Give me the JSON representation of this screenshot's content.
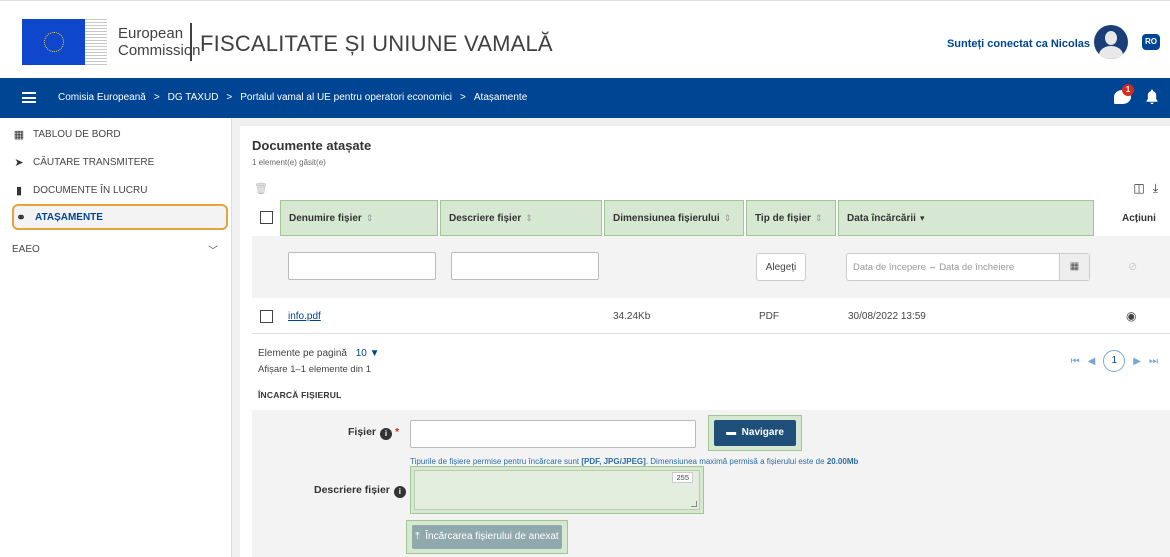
{
  "header": {
    "ec_line1": "European",
    "ec_line2": "Commission",
    "site_title": "FISCALITATE ȘI UNIUNE VAMALĂ",
    "user_label": "Sunteți conectat ca Nicolas",
    "lang": "RO",
    "notification_count": "1"
  },
  "breadcrumb": {
    "items": [
      "Comisia Europeană",
      "DG TAXUD",
      "Portalul vamal al UE pentru operatori economici",
      "Atașamente"
    ],
    "separator": ">"
  },
  "sidebar": {
    "items": [
      {
        "label": "TABLOU DE BORD",
        "icon": "dashboard-icon"
      },
      {
        "label": "CĂUTARE TRANSMITERE",
        "icon": "send-icon"
      },
      {
        "label": "DOCUMENTE ÎN LUCRU",
        "icon": "document-icon"
      },
      {
        "label": "ATAȘAMENTE",
        "icon": "paperclip-icon",
        "active": true
      },
      {
        "label": "EAEO",
        "icon": "chevron-down-icon"
      }
    ]
  },
  "panel": {
    "title": "Documente atașate",
    "subtitle": "1 element(e) găsit(e)"
  },
  "table": {
    "columns": [
      {
        "label": "Denumire fișier",
        "sort": "⇕"
      },
      {
        "label": "Descriere fișier",
        "sort": "⇕"
      },
      {
        "label": "Dimensiunea fișierului",
        "sort": "⇕"
      },
      {
        "label": "Tip de fișier",
        "sort": "⇕"
      },
      {
        "label": "Data încărcării",
        "sort": "▾"
      },
      {
        "label": "Acțiuni"
      }
    ],
    "filters": {
      "choose_label": "Alegeți",
      "date_start": "Data de începere",
      "date_dash": "–",
      "date_end": "Data de încheiere"
    },
    "rows": [
      {
        "name": "info.pdf",
        "description": "",
        "size": "34.24Kb",
        "type": "PDF",
        "date": "30/08/2022 13:59"
      }
    ]
  },
  "pagination": {
    "per_page_label": "Elemente pe pagină",
    "per_page_value": "10",
    "showing": "Afișare 1–1 elemente din 1",
    "current_page": "1"
  },
  "upload": {
    "section_title": "ÎNCARCĂ FIȘIERUL",
    "file_label": "Fișier",
    "required_mark": "*",
    "browse_label": "Navigare",
    "hint_prefix": "Tipurile de fișiere permise pentru încărcare sunt",
    "hint_types": "[PDF, JPG/JPEG]",
    "hint_mid": "Dimensiunea maximă permisă a fișierului este de",
    "hint_size": "20.00Mb",
    "description_label": "Descriere fișier",
    "counter": "255",
    "upload_button": "Încărcarea fișierului de anexat"
  },
  "colors": {
    "brand_blue": "#004494",
    "highlight_green": "#d7e8d2",
    "active_outline": "#e8a23a"
  }
}
